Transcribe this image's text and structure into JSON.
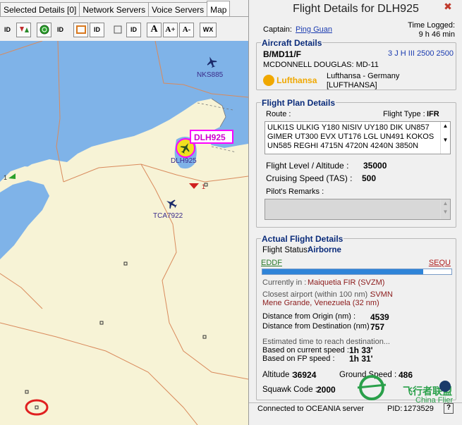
{
  "tabs": [
    {
      "label": "Selected Details [0]"
    },
    {
      "label": "Network Servers"
    },
    {
      "label": "Voice Servers"
    },
    {
      "label": "Map"
    }
  ],
  "toolbar": {
    "id": "ID",
    "font_a": "A",
    "font_a_plus": "A+",
    "font_a_minus": "A-",
    "wx": "WX"
  },
  "map": {
    "aircraft": [
      {
        "label": "NKS885"
      },
      {
        "label": "DLH925"
      },
      {
        "label": "TCA7922"
      }
    ],
    "selected_callout": "DLH925",
    "marker_counts": [
      "1",
      "1"
    ],
    "colors": {
      "sea": "#7fb3e8",
      "land": "#f7f3d6",
      "border": "#d98a5c",
      "highlight": "#ff00ff"
    }
  },
  "details": {
    "title": "Flight Details for DLH925",
    "captain_label": "Captain:",
    "captain_name": "Ping Guan",
    "time_logged_label": "Time Logged:",
    "time_logged_value": "9 h 46 min",
    "aircraft": {
      "section_title": "Aircraft Details",
      "type_code": "B/MD11/F",
      "type_name": "MCDONNELL DOUGLAS: MD-11",
      "codes": "3 J H III 2500 2500",
      "airline_logo": "Lufthansa",
      "airline_name": "Lufthansa - Germany",
      "airline_code": "[LUFTHANSA]"
    },
    "flight_plan": {
      "section_title": "Flight Plan Details",
      "route_label": "Route :",
      "flight_type_label": "Flight Type :",
      "flight_type_value": "IFR",
      "route_lines": [
        "ULKI1S ULKIG Y180 NISIV UY180 DIK UN857",
        "GIMER UT300 EVX UT176 LGL UN491 KOKOS",
        "UN585 REGHI 4715N 4720N 4240N 3850N"
      ],
      "level_label": "Flight Level / Altitude :",
      "level_value": "35000",
      "speed_label": "Cruising Speed (TAS) :",
      "speed_value": "500",
      "remarks_label": "Pilot's Remarks :"
    },
    "actual": {
      "section_title": "Actual Flight Details",
      "status_label": "Flight Status:",
      "status_value": "Airborne",
      "origin": "EDDF",
      "destination": "SEQU",
      "progress_fraction": 0.85,
      "currently_in_label": "Currently in :",
      "currently_in_value": "Maiquetia FIR (SVZM)",
      "closest_label": "Closest airport (within 100 nm) :",
      "closest_value": "SVMN",
      "closest_place": "Mene Grande, Venezuela (32 nm)",
      "dist_origin_label": "Distance from Origin (nm) :",
      "dist_origin_value": "4539",
      "dist_dest_label": "Distance from Destination (nm) :",
      "dist_dest_value": "757",
      "estimated_label": "Estimated time to reach destination...",
      "based_current_label": "Based on current speed :",
      "based_current_value": "1h 33'",
      "based_fp_label": "Based on FP speed :",
      "based_fp_value": "1h 31'",
      "altitude_label": "Altitude :",
      "altitude_value": "36924",
      "ground_speed_label": "Ground Speed :",
      "ground_speed_value": "486",
      "squawk_label": "Squawk Code :",
      "squawk_value": "2000"
    },
    "status_bar": {
      "connected_text": "Connected to OCEANIA server",
      "pid_label": "PID:",
      "pid_value": "1273529",
      "help": "?"
    },
    "watermark": {
      "cn": "飞行者联盟",
      "en": "China Flier"
    }
  }
}
